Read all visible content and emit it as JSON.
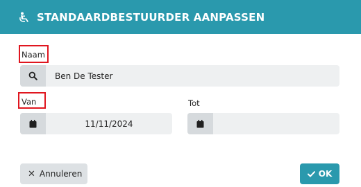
{
  "header": {
    "title": "STANDAARDBESTUURDER AANPASSEN",
    "icon": "driver-seat-icon"
  },
  "form": {
    "naam_label": "Naam",
    "naam_value": "Ben De Tester",
    "van_label": "Van",
    "van_value": "11/11/2024",
    "tot_label": "Tot",
    "tot_value": ""
  },
  "buttons": {
    "cancel_label": "Annuleren",
    "ok_label": "OK"
  },
  "colors": {
    "accent": "#2a99ad",
    "highlight": "#e0161f"
  }
}
